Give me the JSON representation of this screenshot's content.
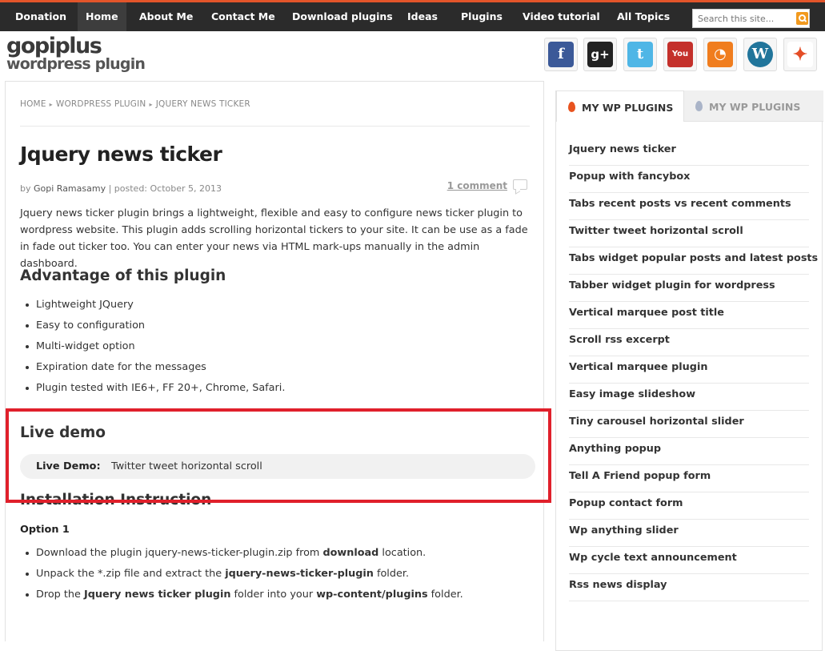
{
  "nav": {
    "items": [
      "Donation",
      "Home",
      "About Me",
      "Contact Me",
      "Download plugins",
      "Ideas",
      "Plugins",
      "Video tutorial",
      "All Topics"
    ],
    "active": "Home",
    "search_placeholder": "Search this site..."
  },
  "logo": {
    "line1": "gopiplus",
    "line2": "wordpress plugin"
  },
  "social": [
    {
      "name": "facebook-icon",
      "glyph": "f",
      "color": "#3b5998"
    },
    {
      "name": "google-plus-icon",
      "glyph": "g+",
      "color": "#222222"
    },
    {
      "name": "twitter-icon",
      "glyph": "t",
      "color": "#4fb6e6"
    },
    {
      "name": "youtube-icon",
      "glyph": "You",
      "color": "#c4302b"
    },
    {
      "name": "rss-icon",
      "glyph": "◔",
      "color": "#f07d1e"
    },
    {
      "name": "wordpress-icon",
      "glyph": "W",
      "color": "#21759b"
    },
    {
      "name": "joomla-icon",
      "glyph": "✦",
      "color": "#ffffff"
    }
  ],
  "breadcrumb": [
    "HOME",
    "WORDPRESS PLUGIN",
    "JQUERY NEWS TICKER"
  ],
  "post": {
    "title": "Jquery news ticker",
    "meta_by": "by ",
    "meta_author": "Gopi Ramasamy",
    "meta_posted": " | posted: October 5, 2013",
    "comments": "1 comment",
    "intro": "Jquery news ticker plugin brings a lightweight, flexible and easy to configure news ticker plugin to wordpress website. This plugin adds scrolling horizontal tickers to your site. It can be use as a fade in fade out ticker too. You can enter your news via HTML mark-ups manually in the admin dashboard.",
    "advantage_heading": "Advantage of this plugin",
    "advantages": [
      "Lightweight JQuery",
      "Easy to configuration",
      "Multi-widget option",
      "Expiration date for the messages",
      "Plugin tested with IE6+, FF 20+, Chrome, Safari."
    ],
    "live_demo_heading": "Live demo",
    "live_demo_label": "Live Demo:",
    "live_demo_link": "Twitter tweet horizontal scroll",
    "install_heading": "Installation Instruction",
    "option_label": "Option 1",
    "steps": [
      {
        "pre": "Download the plugin jquery-news-ticker-plugin.zip from ",
        "bold": "download",
        "post": " location."
      },
      {
        "pre": "Unpack the *.zip file and extract the ",
        "bold": "jquery-news-ticker-plugin",
        "post": " folder."
      },
      {
        "pre": "Drop the ",
        "bold": "Jquery news ticker plugin",
        "post": " folder into your ",
        "bold2": "wp-content/plugins",
        "post2": " folder."
      }
    ]
  },
  "sidebar": {
    "tab_active": "MY WP PLUGINS",
    "tab_inactive": "MY WP PLUGINS",
    "items": [
      "Jquery news ticker",
      "Popup with fancybox",
      "Tabs recent posts vs recent comments",
      "Twitter tweet horizontal scroll",
      "Tabs widget popular posts and latest posts",
      "Tabber widget plugin for wordpress",
      "Vertical marquee post title",
      "Scroll rss excerpt",
      "Vertical marquee plugin",
      "Easy image slideshow",
      "Tiny carousel horizontal slider",
      "Anything popup",
      "Tell A Friend popup form",
      "Popup contact form",
      "Wp anything slider",
      "Wp cycle text announcement",
      "Rss news display"
    ]
  }
}
